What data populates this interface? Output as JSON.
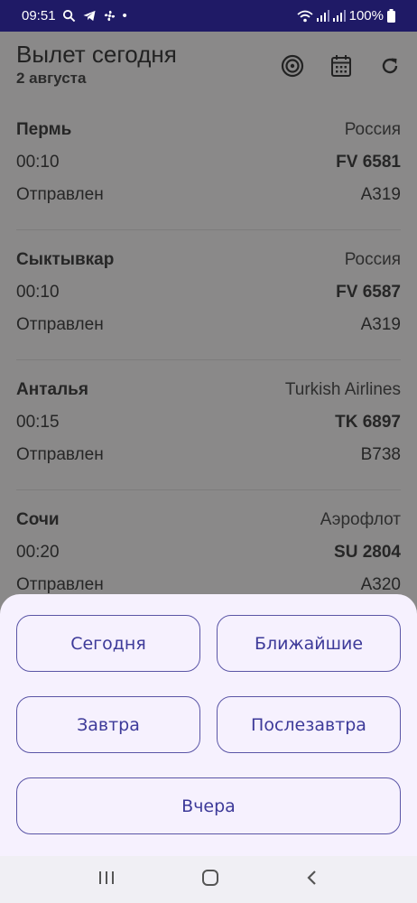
{
  "status_bar": {
    "time": "09:51",
    "dot": "•",
    "battery": "100%"
  },
  "header": {
    "title": "Вылет сегодня",
    "date": "2 августа"
  },
  "icons": {
    "target": "target-icon",
    "calendar": "calendar-icon",
    "refresh": "refresh-icon",
    "nav_recents": "recents-icon",
    "nav_home": "home-icon",
    "nav_back": "back-icon"
  },
  "flights": [
    {
      "city": "Пермь",
      "carrier": "Россия",
      "time": "00:10",
      "number": "FV 6581",
      "status": "Отправлен",
      "aircraft": "A319"
    },
    {
      "city": "Сыктывкар",
      "carrier": "Россия",
      "time": "00:10",
      "number": "FV 6587",
      "status": "Отправлен",
      "aircraft": "A319"
    },
    {
      "city": "Анталья",
      "carrier": "Turkish Airlines",
      "time": "00:15",
      "number": "TK 6897",
      "status": "Отправлен",
      "aircraft": "B738"
    },
    {
      "city": "Сочи",
      "carrier": "Аэрофлот",
      "time": "00:20",
      "number": "SU 2804",
      "status": "Отправлен",
      "aircraft": "A320"
    }
  ],
  "sheet": {
    "today": "Сегодня",
    "nearest": "Ближайшие",
    "tomorrow": "Завтра",
    "day_after": "Послезавтра",
    "yesterday": "Вчера"
  },
  "colors": {
    "accent": "#3d3a99",
    "status_bar": "#1f1a66",
    "sheet_bg": "#f6f1fe"
  }
}
